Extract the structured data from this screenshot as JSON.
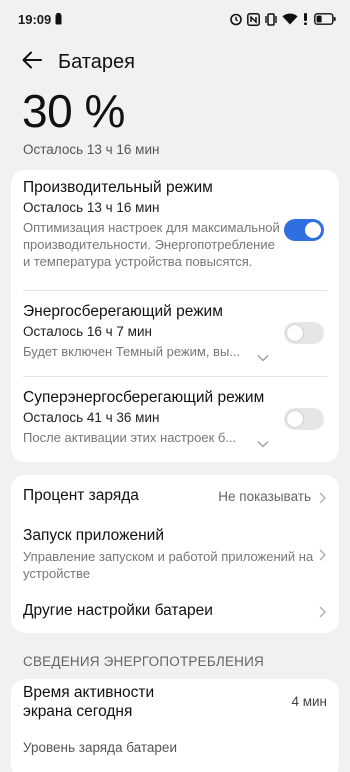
{
  "status_bar": {
    "time": "19:09"
  },
  "header": {
    "title": "Батарея"
  },
  "battery": {
    "percent": "30 %",
    "remaining": "Осталось 13 ч 16 мин"
  },
  "modes": [
    {
      "title": "Производительный режим",
      "remaining": "Осталось 13 ч 16 мин",
      "description": "Оптимизация настроек для максимальной производительности. Энергопотребление и температура устройства повысятся.",
      "enabled": true
    },
    {
      "title": "Энергосберегающий режим",
      "remaining": "Осталось 16 ч 7 мин",
      "description": "Будет включен Темный режим, вы...",
      "enabled": false
    },
    {
      "title": "Суперэнергосберегающий режим",
      "remaining": "Осталось 41 ч 36 мин",
      "description": "После активации этих настроек б...",
      "enabled": false
    }
  ],
  "settings": {
    "charge_percent": {
      "title": "Процент заряда",
      "value": "Не показывать"
    },
    "app_launch": {
      "title": "Запуск приложений",
      "subtitle": "Управление запуском и работой приложений на устройстве"
    },
    "other": {
      "title": "Другие настройки батареи"
    }
  },
  "usage": {
    "section_title": "СВЕДЕНИЯ ЭНЕРГОПОТРЕБЛЕНИЯ",
    "screen_time_label": "Время активности экрана сегодня",
    "screen_time_value": "4 мин",
    "battery_level_label": "Уровень заряда батареи"
  },
  "colors": {
    "accent": "#2f6fe0",
    "background": "#f1f1f3",
    "card": "#ffffff"
  }
}
